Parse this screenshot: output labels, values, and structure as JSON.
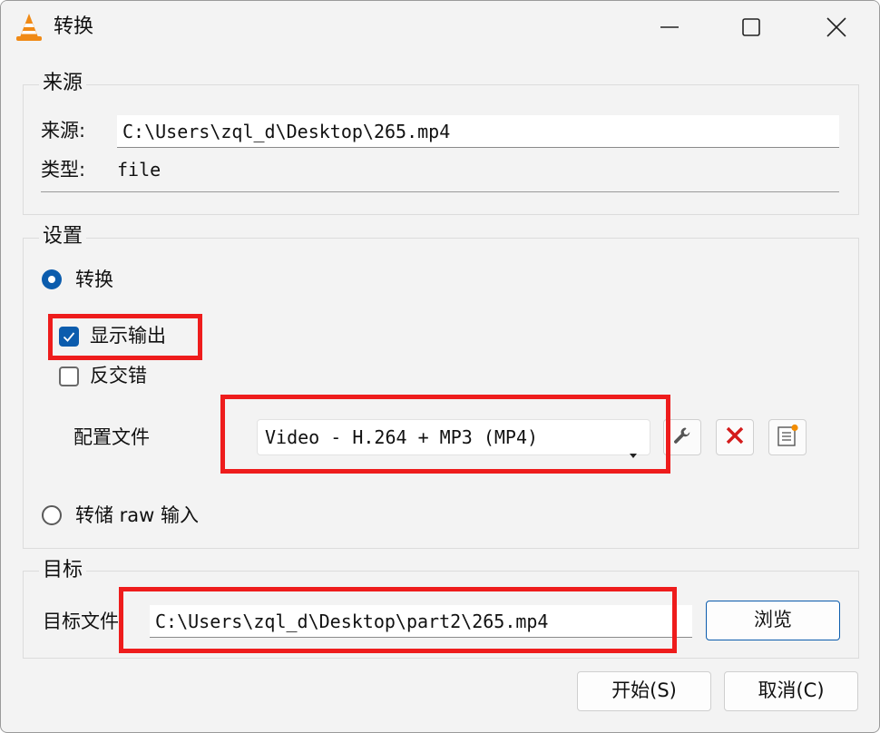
{
  "window": {
    "title": "转换"
  },
  "source": {
    "group_title": "来源",
    "source_label": "来源:",
    "source_value": "C:\\Users\\zql_d\\Desktop\\265.mp4",
    "type_label": "类型:",
    "type_value": "file"
  },
  "settings": {
    "group_title": "设置",
    "convert_label": "转换",
    "convert_selected": true,
    "display_output_label": "显示输出",
    "display_output_checked": true,
    "deinterlace_label": "反交错",
    "deinterlace_checked": false,
    "profile_label": "配置文件",
    "profile_value": "Video - H.264 + MP3 (MP4)",
    "dump_raw_label": "转储 raw 输入",
    "dump_raw_selected": false
  },
  "destination": {
    "group_title": "目标",
    "file_label": "目标文件:",
    "file_value": "C:\\Users\\zql_d\\Desktop\\part2\\265.mp4",
    "browse_label": "浏览"
  },
  "footer": {
    "start_label": "开始(S)",
    "cancel_label": "取消(C)"
  },
  "colors": {
    "accent": "#0b5cad",
    "highlight": "#ee1c1c",
    "delete_icon": "#d41c1c",
    "new_profile_dot": "#f28c00"
  },
  "icons": {
    "app": "vlc-cone-icon",
    "minimize": "minimize-icon",
    "maximize": "maximize-icon",
    "close": "close-icon",
    "edit_profile": "wrench-icon",
    "delete_profile": "red-x-icon",
    "new_profile": "new-document-icon"
  }
}
